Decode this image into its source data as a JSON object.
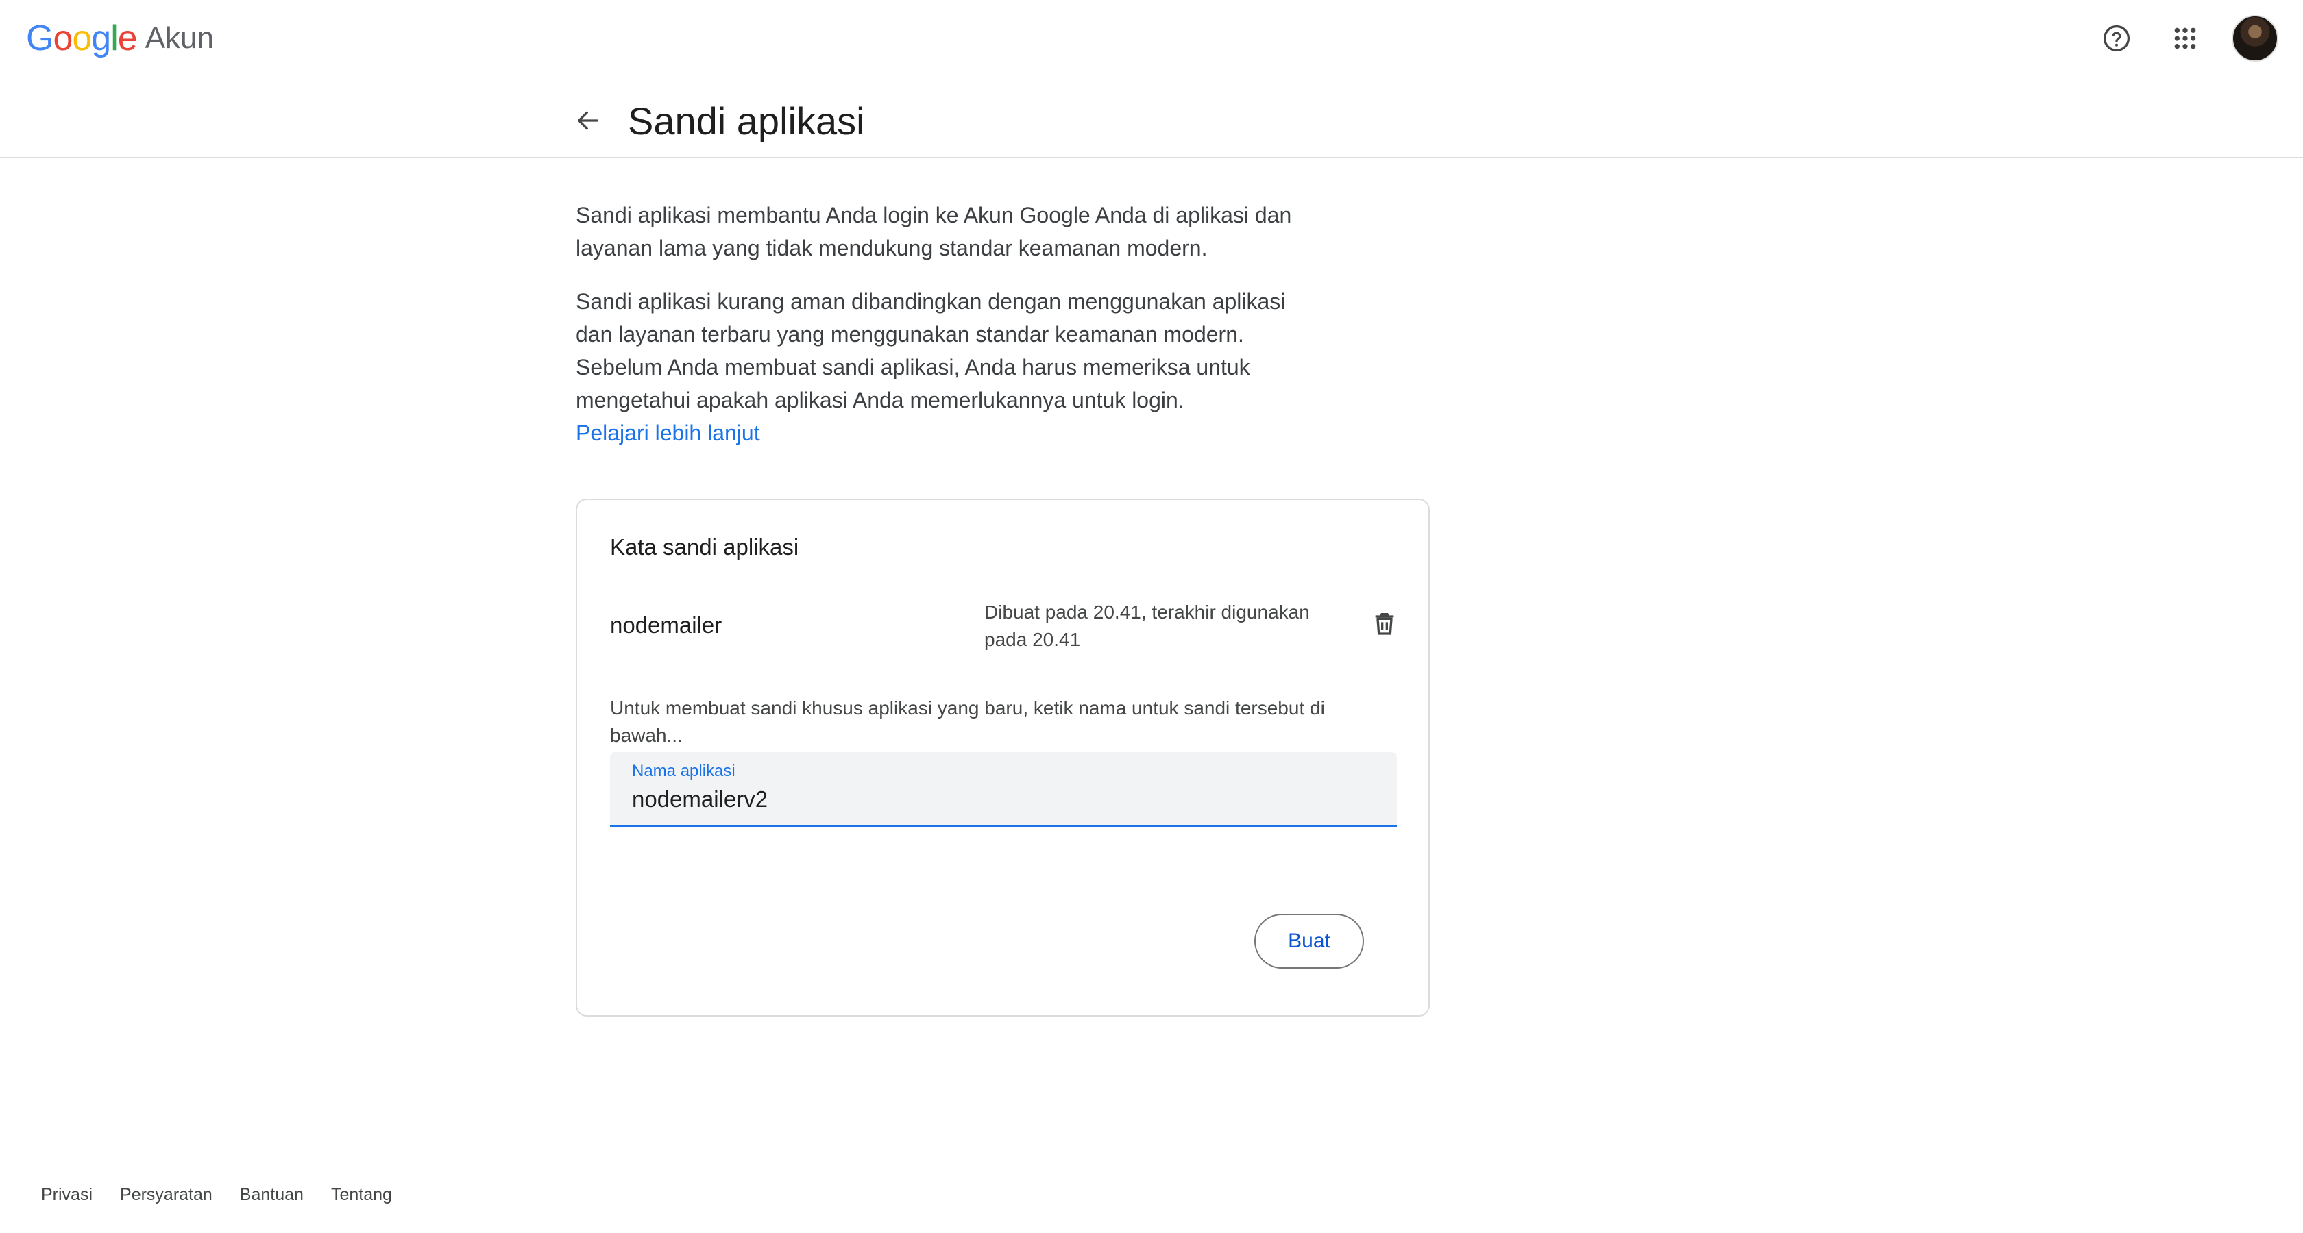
{
  "header": {
    "logo_google": [
      "G",
      "o",
      "o",
      "g",
      "l",
      "e"
    ],
    "logo_colors": [
      "#4285F4",
      "#EA4335",
      "#FBBC05",
      "#4285F4",
      "#34A853",
      "#EA4335"
    ],
    "logo_product": "Akun",
    "icons": [
      "help-icon",
      "apps-icon",
      "avatar"
    ]
  },
  "page": {
    "title": "Sandi aplikasi",
    "para1": "Sandi aplikasi membantu Anda login ke Akun Google Anda di aplikasi dan layanan lama yang tidak mendukung standar keamanan modern.",
    "para2": "Sandi aplikasi kurang aman dibandingkan dengan menggunakan aplikasi dan layanan terbaru yang menggunakan standar keamanan modern. Sebelum Anda membuat sandi aplikasi, Anda harus memeriksa untuk mengetahui apakah aplikasi Anda memerlukannya untuk login.",
    "learn_more": "Pelajari lebih lanjut"
  },
  "card": {
    "title": "Kata sandi aplikasi",
    "passwords": [
      {
        "name": "nodemailer",
        "meta": "Dibuat pada 20.41, terakhir digunakan pada 20.41"
      }
    ],
    "hint": "Untuk membuat sandi khusus aplikasi yang baru, ketik nama untuk sandi tersebut di bawah...",
    "field_label": "Nama aplikasi",
    "field_value": "nodemailerv2",
    "create_label": "Buat"
  },
  "footer": {
    "links": [
      "Privasi",
      "Persyaratan",
      "Bantuan",
      "Tentang"
    ]
  },
  "colors": {
    "accent": "#1a73e8",
    "button_text": "#0b57d0",
    "divider": "#dadce0"
  }
}
